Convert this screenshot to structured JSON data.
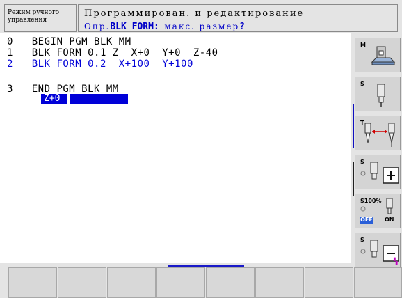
{
  "header": {
    "mode_line1": "Режим ручного",
    "mode_line2": "управления",
    "title": "Программирован. и редактирование",
    "prompt_prefix": "Опр.",
    "prompt_bold": "BLK FORM:",
    "prompt_rest": "макс. размер",
    "prompt_q": "?"
  },
  "program": {
    "lines": [
      {
        "num": "0",
        "text": "BEGIN PGM BLK MM"
      },
      {
        "num": "1",
        "text": "BLK FORM 0.1 Z  X+0  Y+0  Z-40"
      },
      {
        "num": "2",
        "text": "BLK FORM 0.2  X+100  Y+100"
      },
      {
        "num": "3",
        "text": "END PGM BLK MM"
      }
    ],
    "edit_value": "Z+0"
  },
  "softkeys_vertical": [
    {
      "label": "M",
      "icon": "machine-icon"
    },
    {
      "label": "S",
      "icon": "spindle-icon"
    },
    {
      "label": "T",
      "icon": "tool-length-icon"
    },
    {
      "label": "S",
      "icon": "spindle-plus-icon"
    },
    {
      "label": "S100%",
      "icon": "override-icon",
      "off": "OFF",
      "on": "ON"
    },
    {
      "label": "S",
      "icon": "spindle-minus-icon"
    }
  ],
  "softkeys_horizontal": [
    "",
    "",
    "",
    "",
    "",
    "",
    "",
    ""
  ],
  "colors": {
    "accent": "#0000d8",
    "background": "#e4e4e4",
    "editor_bg": "#ffffff"
  }
}
